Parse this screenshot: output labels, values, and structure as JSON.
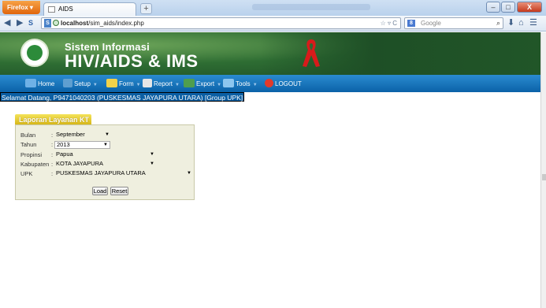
{
  "browser": {
    "menu_button": "Firefox",
    "tab_title": "AIDS",
    "new_tab": "+",
    "url_host": "localhost",
    "url_path": "/sim_aids/index.php",
    "search_placeholder": "Google",
    "min": "–",
    "max": "□",
    "close": "X"
  },
  "header": {
    "subtitle": "Sistem Informasi",
    "title": "HIV/AIDS & IMS"
  },
  "menu": {
    "items": [
      {
        "label": "Home"
      },
      {
        "label": "Setup"
      },
      {
        "label": "Form"
      },
      {
        "label": "Report"
      },
      {
        "label": "Export"
      },
      {
        "label": "Tools"
      },
      {
        "label": "LOGOUT"
      }
    ]
  },
  "welcome": "Selamat Datang, P9471040203 (PUSKESMAS JAYAPURA UTARA) [Group UPK]",
  "panel": {
    "title": "Laporan Layanan KT",
    "fields": {
      "bulan": {
        "label": "Bulan",
        "value": "September"
      },
      "tahun": {
        "label": "Tahun",
        "value": "2013"
      },
      "propinsi": {
        "label": "Propinsi",
        "value": "Papua"
      },
      "kabupaten": {
        "label": "Kabupaten",
        "value": "KOTA JAYAPURA"
      },
      "upk": {
        "label": "UPK",
        "value": "PUSKESMAS JAYAPURA UTARA"
      }
    },
    "load_label": "Load",
    "reset_label": "Reset"
  },
  "colors": {
    "header_green": "#2e6d33",
    "menu_blue": "#0b62a8",
    "panel_tab": "#d5b414",
    "panel_bg": "#efefdf"
  }
}
